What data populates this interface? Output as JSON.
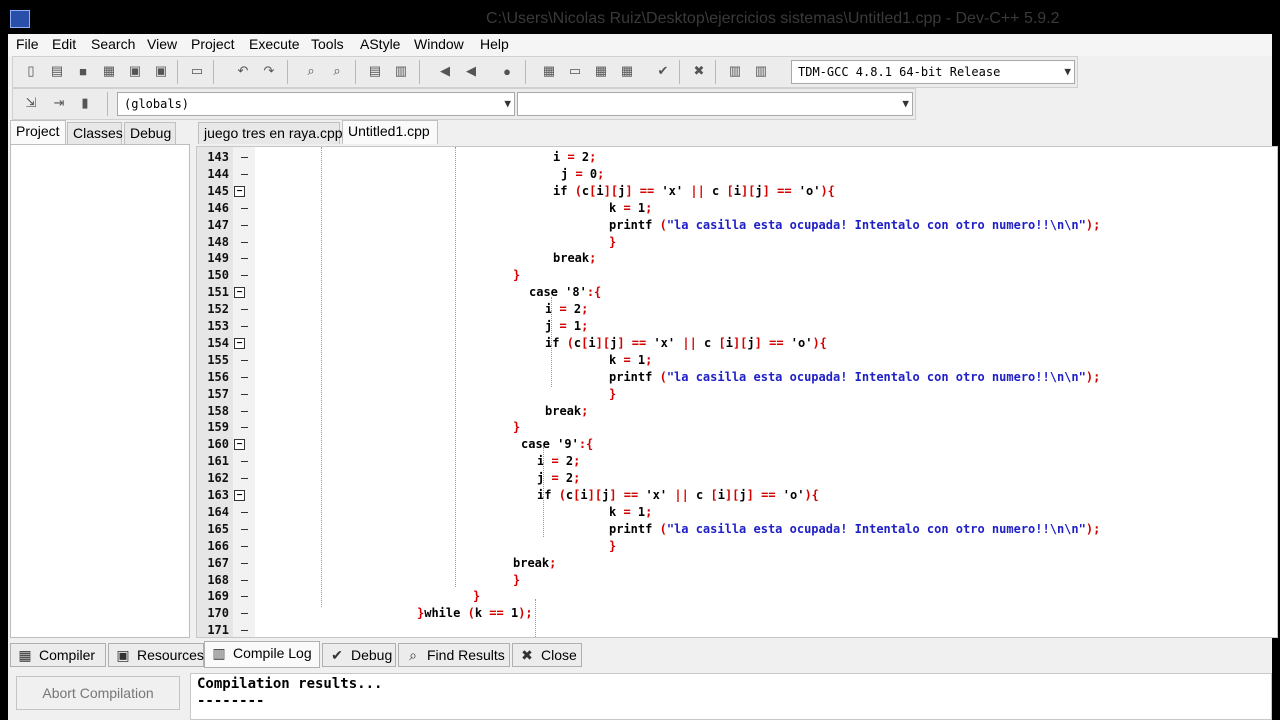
{
  "window": {
    "title": "C:\\Users\\Nicolas Ruiz\\Desktop\\ejercicios sistemas\\Untitled1.cpp - Dev-C++ 5.9.2"
  },
  "menu": [
    "File",
    "Edit",
    "Search",
    "View",
    "Project",
    "Execute",
    "Tools",
    "AStyle",
    "Window",
    "Help"
  ],
  "toolbar": {
    "compiler_select": "TDM-GCC 4.8.1 64-bit Release",
    "scope_select": "(globals)",
    "member_select": ""
  },
  "left_tabs": [
    "Project",
    "Classes",
    "Debug"
  ],
  "file_tabs": [
    "juego tres en raya.cpp",
    "Untitled1.cpp"
  ],
  "code_lines": [
    {
      "n": "143",
      "parts": [
        [
          "i ",
          "kw"
        ],
        [
          "= ",
          "sym"
        ],
        [
          "2",
          "kw"
        ],
        [
          ";",
          "sym"
        ]
      ]
    },
    {
      "n": "144",
      "parts": [
        [
          "j ",
          "kw"
        ],
        [
          "= ",
          "sym"
        ],
        [
          "0",
          "kw"
        ],
        [
          ";",
          "sym"
        ]
      ]
    },
    {
      "n": "145",
      "parts": [
        [
          "if ",
          "kw"
        ],
        [
          "(",
          "sym"
        ],
        [
          "c",
          "kw"
        ],
        [
          "[",
          "sym"
        ],
        [
          "i",
          "kw"
        ],
        [
          "][",
          "sym"
        ],
        [
          "j",
          "kw"
        ],
        [
          "] == ",
          "sym"
        ],
        [
          "'x' ",
          "kw"
        ],
        [
          "|| ",
          "sym"
        ],
        [
          "c ",
          "kw"
        ],
        [
          "[",
          "sym"
        ],
        [
          "i",
          "kw"
        ],
        [
          "][",
          "sym"
        ],
        [
          "j",
          "kw"
        ],
        [
          "] == ",
          "sym"
        ],
        [
          "'o'",
          "kw"
        ],
        [
          "){",
          "sym"
        ]
      ]
    },
    {
      "n": "146",
      "parts": [
        [
          "k ",
          "kw"
        ],
        [
          "= ",
          "sym"
        ],
        [
          "1",
          "kw"
        ],
        [
          ";",
          "sym"
        ]
      ]
    },
    {
      "n": "147",
      "parts": [
        [
          "printf ",
          "kw"
        ],
        [
          "(",
          "sym"
        ],
        [
          "\"la casilla esta ocupada! Intentalo con otro numero!!\\n\\n\"",
          "str"
        ],
        [
          ");",
          "sym"
        ]
      ]
    },
    {
      "n": "148",
      "parts": [
        [
          "}",
          "sym"
        ]
      ]
    },
    {
      "n": "149",
      "parts": [
        [
          "break",
          "kw"
        ],
        [
          ";",
          "sym"
        ]
      ]
    },
    {
      "n": "150",
      "parts": [
        [
          "}",
          "sym"
        ]
      ]
    },
    {
      "n": "151",
      "parts": [
        [
          "case ",
          "kw"
        ],
        [
          "'8'",
          "kw"
        ],
        [
          ":{",
          "sym"
        ]
      ]
    },
    {
      "n": "152",
      "parts": [
        [
          "i ",
          "kw"
        ],
        [
          "= ",
          "sym"
        ],
        [
          "2",
          "kw"
        ],
        [
          ";",
          "sym"
        ]
      ]
    },
    {
      "n": "153",
      "parts": [
        [
          "j ",
          "kw"
        ],
        [
          "= ",
          "sym"
        ],
        [
          "1",
          "kw"
        ],
        [
          ";",
          "sym"
        ]
      ]
    },
    {
      "n": "154",
      "parts": [
        [
          "if ",
          "kw"
        ],
        [
          "(",
          "sym"
        ],
        [
          "c",
          "kw"
        ],
        [
          "[",
          "sym"
        ],
        [
          "i",
          "kw"
        ],
        [
          "][",
          "sym"
        ],
        [
          "j",
          "kw"
        ],
        [
          "] == ",
          "sym"
        ],
        [
          "'x' ",
          "kw"
        ],
        [
          "|| ",
          "sym"
        ],
        [
          "c ",
          "kw"
        ],
        [
          "[",
          "sym"
        ],
        [
          "i",
          "kw"
        ],
        [
          "][",
          "sym"
        ],
        [
          "j",
          "kw"
        ],
        [
          "] == ",
          "sym"
        ],
        [
          "'o'",
          "kw"
        ],
        [
          "){",
          "sym"
        ]
      ]
    },
    {
      "n": "155",
      "parts": [
        [
          "k ",
          "kw"
        ],
        [
          "= ",
          "sym"
        ],
        [
          "1",
          "kw"
        ],
        [
          ";",
          "sym"
        ]
      ]
    },
    {
      "n": "156",
      "parts": [
        [
          "printf ",
          "kw"
        ],
        [
          "(",
          "sym"
        ],
        [
          "\"la casilla esta ocupada! Intentalo con otro numero!!\\n\\n\"",
          "str"
        ],
        [
          ");",
          "sym"
        ]
      ]
    },
    {
      "n": "157",
      "parts": [
        [
          "}",
          "sym"
        ]
      ]
    },
    {
      "n": "158",
      "parts": [
        [
          "break",
          "kw"
        ],
        [
          ";",
          "sym"
        ]
      ]
    },
    {
      "n": "159",
      "parts": [
        [
          "}",
          "sym"
        ]
      ]
    },
    {
      "n": "160",
      "parts": [
        [
          "case ",
          "kw"
        ],
        [
          "'9'",
          "kw"
        ],
        [
          ":{",
          "sym"
        ]
      ]
    },
    {
      "n": "161",
      "parts": [
        [
          "i ",
          "kw"
        ],
        [
          "= ",
          "sym"
        ],
        [
          "2",
          "kw"
        ],
        [
          ";",
          "sym"
        ]
      ]
    },
    {
      "n": "162",
      "parts": [
        [
          "j ",
          "kw"
        ],
        [
          "= ",
          "sym"
        ],
        [
          "2",
          "kw"
        ],
        [
          ";",
          "sym"
        ]
      ]
    },
    {
      "n": "163",
      "parts": [
        [
          "if ",
          "kw"
        ],
        [
          "(",
          "sym"
        ],
        [
          "c",
          "kw"
        ],
        [
          "[",
          "sym"
        ],
        [
          "i",
          "kw"
        ],
        [
          "][",
          "sym"
        ],
        [
          "j",
          "kw"
        ],
        [
          "] == ",
          "sym"
        ],
        [
          "'x' ",
          "kw"
        ],
        [
          "|| ",
          "sym"
        ],
        [
          "c ",
          "kw"
        ],
        [
          "[",
          "sym"
        ],
        [
          "i",
          "kw"
        ],
        [
          "][",
          "sym"
        ],
        [
          "j",
          "kw"
        ],
        [
          "] == ",
          "sym"
        ],
        [
          "'o'",
          "kw"
        ],
        [
          "){",
          "sym"
        ]
      ]
    },
    {
      "n": "164",
      "parts": [
        [
          "k ",
          "kw"
        ],
        [
          "= ",
          "sym"
        ],
        [
          "1",
          "kw"
        ],
        [
          ";",
          "sym"
        ]
      ]
    },
    {
      "n": "165",
      "parts": [
        [
          "printf ",
          "kw"
        ],
        [
          "(",
          "sym"
        ],
        [
          "\"la casilla esta ocupada! Intentalo con otro numero!!\\n\\n\"",
          "str"
        ],
        [
          ");",
          "sym"
        ]
      ]
    },
    {
      "n": "166",
      "parts": [
        [
          "}",
          "sym"
        ]
      ]
    },
    {
      "n": "167",
      "parts": [
        [
          "break",
          "kw"
        ],
        [
          ";",
          "sym"
        ]
      ]
    },
    {
      "n": "168",
      "parts": [
        [
          "}",
          "sym"
        ]
      ]
    },
    {
      "n": "169",
      "parts": [
        [
          "}",
          "sym"
        ]
      ]
    },
    {
      "n": "170",
      "parts": [
        [
          "}",
          "sym"
        ],
        [
          "while ",
          "kw"
        ],
        [
          "(",
          "sym"
        ],
        [
          "k ",
          "kw"
        ],
        [
          "== ",
          "sym"
        ],
        [
          "1",
          "kw"
        ],
        [
          ");",
          "sym"
        ]
      ]
    },
    {
      "n": "171",
      "parts": []
    }
  ],
  "bottom_tabs": [
    "Compiler",
    "Resources",
    "Compile Log",
    "Debug",
    "Find Results",
    "Close"
  ],
  "bottom_panel": {
    "abort_button": "Abort Compilation",
    "log_lines": [
      "Compilation results...",
      "--------"
    ]
  }
}
